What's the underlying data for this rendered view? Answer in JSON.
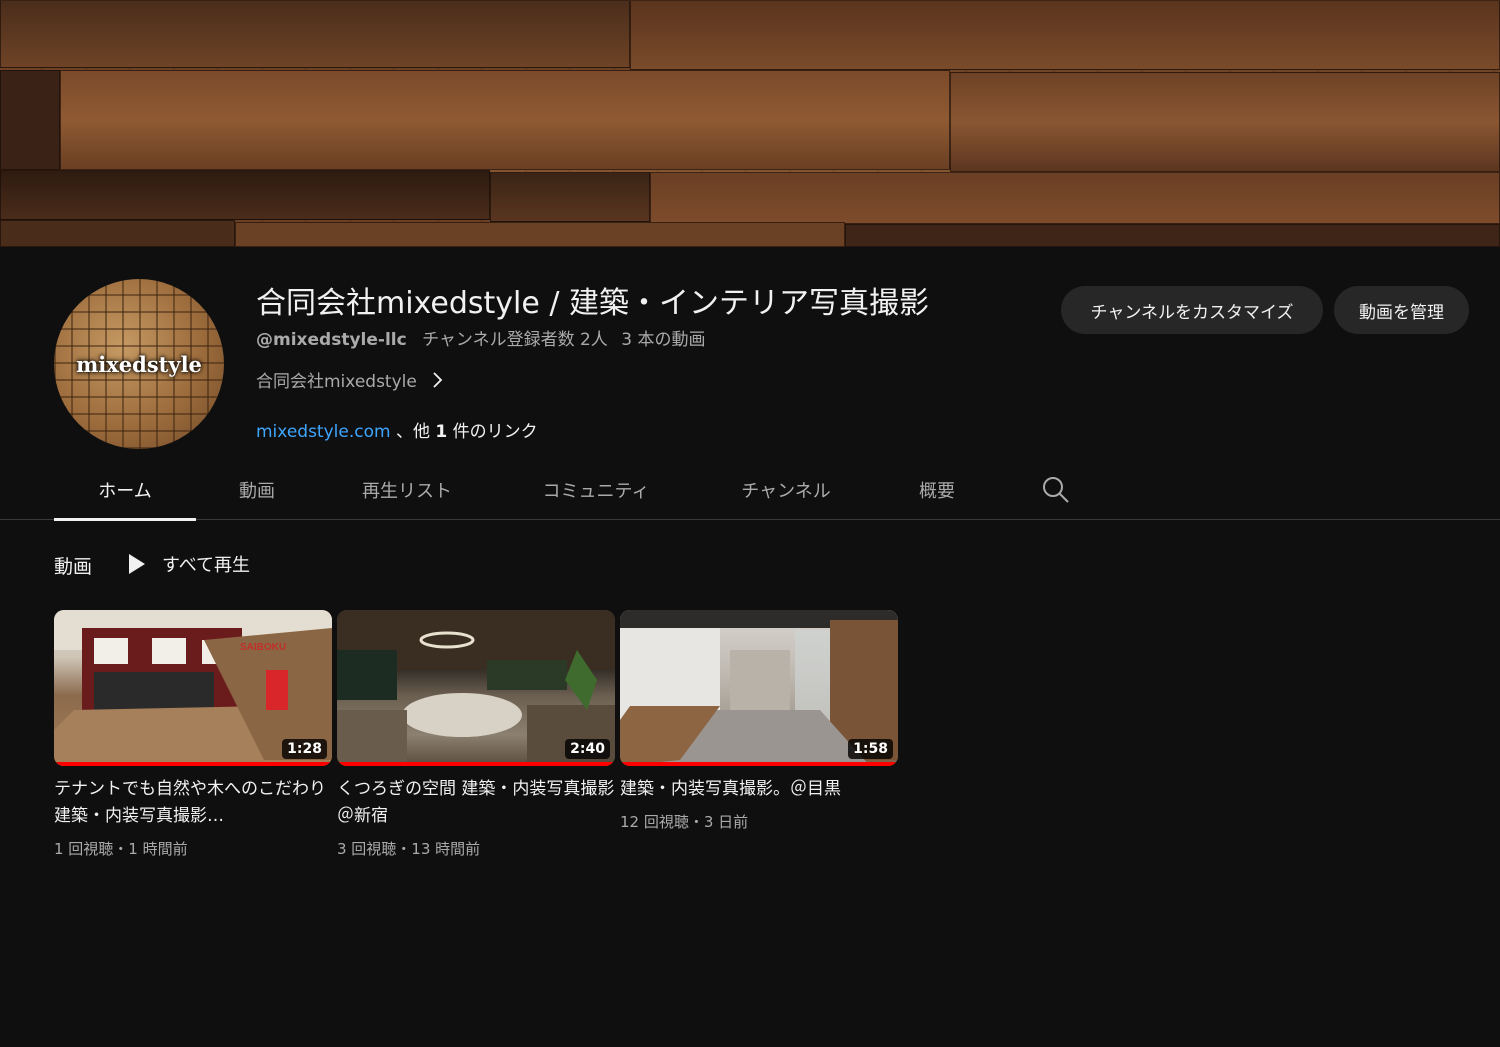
{
  "channel": {
    "title": "合同会社mixedstyle / 建築・インテリア写真撮影",
    "handle": "@mixedstyle-llc",
    "subscribers": "チャンネル登録者数 2人",
    "video_count": "3 本の動画",
    "description": "合同会社mixedstyle",
    "link_url": "mixedstyle.com",
    "link_suffix_pre": "、他 ",
    "link_suffix_count": "1",
    "link_suffix_post": " 件のリンク",
    "avatar_text": "mixedstyle"
  },
  "buttons": {
    "customize": "チャンネルをカスタマイズ",
    "manage": "動画を管理"
  },
  "tabs": [
    {
      "label": "ホーム",
      "active": true
    },
    {
      "label": "動画"
    },
    {
      "label": "再生リスト"
    },
    {
      "label": "コミュニティ"
    },
    {
      "label": "チャンネル"
    },
    {
      "label": "概要"
    }
  ],
  "section": {
    "title": "動画",
    "play_all": "すべて再生"
  },
  "videos": [
    {
      "title": "テナントでも自然や木へのこだわり 建築・内装写真撮影…",
      "duration": "1:28",
      "meta": "1 回視聴・1 時間前",
      "progress": 1.0
    },
    {
      "title": "くつろぎの空間 建築・内装写真撮影＠新宿",
      "duration": "2:40",
      "meta": "3 回視聴・13 時間前",
      "progress": 1.0
    },
    {
      "title": "建築・内装写真撮影。＠目黒",
      "duration": "1:58",
      "meta": "12 回視聴・3 日前",
      "progress": 1.0
    }
  ],
  "icons": {
    "search": "search-icon",
    "chevron": "chevron-right-icon",
    "play": "play-icon"
  },
  "colors": {
    "background": "#0f0f0f",
    "link": "#3ea6ff",
    "progress": "#ff0000",
    "button": "#272727"
  }
}
